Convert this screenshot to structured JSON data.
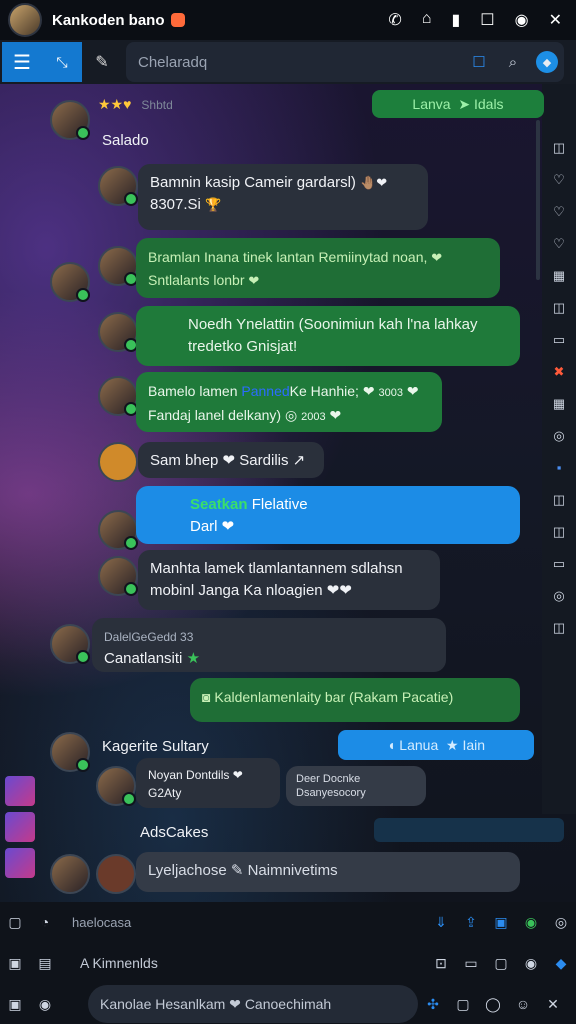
{
  "status_bar": {
    "title": "Kankoden bano",
    "icons": [
      "call-icon",
      "home-icon",
      "signal-icon",
      "square-icon",
      "record-icon",
      "close-icon"
    ]
  },
  "header": {
    "search_placeholder": "Chelaradq",
    "icons": [
      "menu-icon",
      "expand-icon",
      "tool-icon",
      "compose-icon",
      "search-icon",
      "globe-icon"
    ]
  },
  "top": {
    "stars_label": "Shbtd",
    "pill_left": "Lanva",
    "pill_right": "Idals",
    "salado": "Salado"
  },
  "messages": [
    {
      "text1": "Bamnin kasip Cameir gardarsl)",
      "text2": "8307.Si"
    },
    {
      "text1": "Bramlan Inana tinek lantan Remiinytad noan,",
      "text2": "Sntlalants lonbr"
    },
    {
      "text1": "Noedh Ynelattin (Soonimiun kah l'na lahkay",
      "text2": "tredetko Gnisjat!"
    },
    {
      "text1": "Bamelo lamen",
      "highlight": "Panned",
      "text1b": "Ke Hanhie;",
      "num1": "3003",
      "text2": "Fandaj lanel delkany)",
      "num2": "2003"
    },
    {
      "text1": "Sam bhep",
      "text1b": "Sardilis"
    },
    {
      "text1": "Seatkan",
      "text1b": "Flelative",
      "text2": "Darl"
    },
    {
      "text1": "Manhta lamek tlamlantannem sdlahsn",
      "text2": "mobinl Janga Ka nloagien"
    },
    {
      "name": "DalelGeGedd 33",
      "text2": "Canatlansiti"
    },
    {
      "text1": "Kaldenlamenlaity bar (Rakam Pacatie)"
    },
    {
      "name": "Kagerite Sultary",
      "text1": "Noyan Dontdils",
      "text2": "G2Aty"
    },
    {
      "text1": "Deer Docnke",
      "text2": "Dsanyesocory"
    }
  ],
  "pill_blue": {
    "left": "Lanua",
    "right": "Iain"
  },
  "subheading": "AdsCakes",
  "last_message": {
    "text1": "Lyeljachose",
    "text1b": "Naimnivetims"
  },
  "bottom": {
    "row1_label": "haelocasa",
    "row2_label": "A  Kimnenlds",
    "row3_input": "Kanolae Hesanlkam",
    "row3_input_b": "Canoechimah"
  },
  "colors": {
    "accent_blue": "#1c8ce6",
    "green_bubble": "#1f7a3a",
    "dark_bubble": "#2a303b"
  }
}
